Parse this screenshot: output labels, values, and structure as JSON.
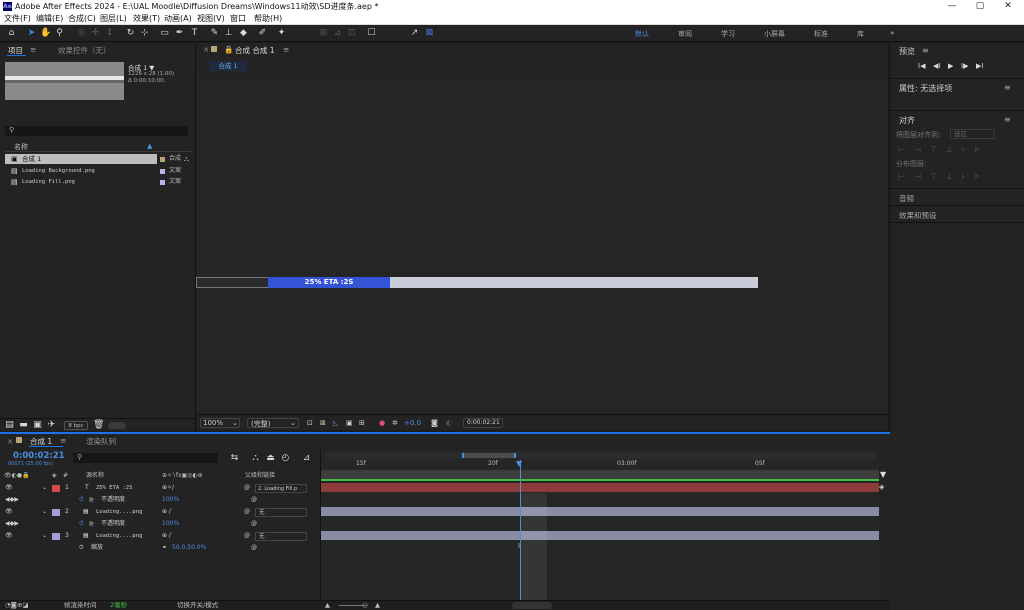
{
  "window": {
    "title": "Adobe After Effects 2024 - E:\\UAL Moodle\\Diffusion Dreams\\Windows11动效\\SD进度条.aep *",
    "app_icon": "Ae",
    "minimize": "—",
    "maximize": "▢",
    "close": "✕"
  },
  "menu": [
    "文件(F)",
    "编辑(E)",
    "合成(C)",
    "图层(L)",
    "效果(T)",
    "动画(A)",
    "视图(V)",
    "窗口",
    "帮助(H)"
  ],
  "toolbar": {
    "snap_label": "对齐",
    "workspaces": [
      "默认",
      "审阅",
      "学习",
      "小屏幕",
      "标准",
      "库"
    ],
    "active_workspace": "默认",
    "more": "»"
  },
  "project": {
    "tab_project": "项目",
    "tab_effects": "效果控件（无）",
    "comp_name": "合成 1 ▼",
    "comp_size": "1226 x 28 (1.00)",
    "comp_duration": "Δ 0:00:10:00,",
    "col_name": "名称",
    "items": [
      {
        "name": "合成 1",
        "type": "合成",
        "color": "#b8a57a"
      },
      {
        "name": "Loading Background.png",
        "type": "文案",
        "color": "#b8b3e8"
      },
      {
        "name": "Loading Fill.png",
        "type": "文案",
        "color": "#b8b3e8"
      }
    ],
    "bpc": "8 bpc"
  },
  "composition": {
    "tab_label": "合成 合成 1",
    "sub_tab": "合成 1",
    "progress_text": "25% ETA :2S",
    "zoom": "100%",
    "resolution": "(完整)",
    "exposure": "+0.0",
    "timecode": "0:00:02:21"
  },
  "right": {
    "preview": "预览",
    "properties": "属性: 无选择项",
    "align": "对齐",
    "align_to_label": "将图层对齐到:",
    "align_to_value": "选区",
    "distribute_label": "分布图层:",
    "audio": "音频",
    "effects": "效果和预设",
    "preview_controls": [
      "I◀",
      "◀I",
      "▶",
      "I▶",
      "▶I"
    ]
  },
  "timeline": {
    "tab_comp": "合成 1",
    "tab_render": "渲染队列",
    "timecode": "0:00:02:21",
    "frames": "00071 (25.00 fps)",
    "col_source": "源名称",
    "col_parent": "父级和链接",
    "ruler": [
      "15f",
      "20f",
      "03:00f",
      "05f"
    ],
    "layers": [
      {
        "index": "1",
        "name": "25% ETA :2S",
        "parent": "2. Loading Fill.p",
        "color": "#d64b4b",
        "prop": "不透明度",
        "prop_value": "100%"
      },
      {
        "index": "2",
        "name": "Loading....png",
        "parent": "无",
        "color": "#a0a0d8",
        "prop": "不透明度",
        "prop_value": "100%"
      },
      {
        "index": "3",
        "name": "Loading....png",
        "parent": "无",
        "color": "#a0a0d8",
        "prop": "缩放",
        "prop_value": "50.0,50.0%"
      }
    ],
    "footer_render_label": "帧渲染时间",
    "footer_render_value": "2毫秒",
    "footer_switch": "切换开关/模式"
  },
  "colors": {
    "accent": "#1a73e8",
    "progress_fill": "#3354d4",
    "progress_bg": "#c9ccd9",
    "layer_red": "#8c3a3a",
    "layer_purple": "#8a8ca6"
  }
}
